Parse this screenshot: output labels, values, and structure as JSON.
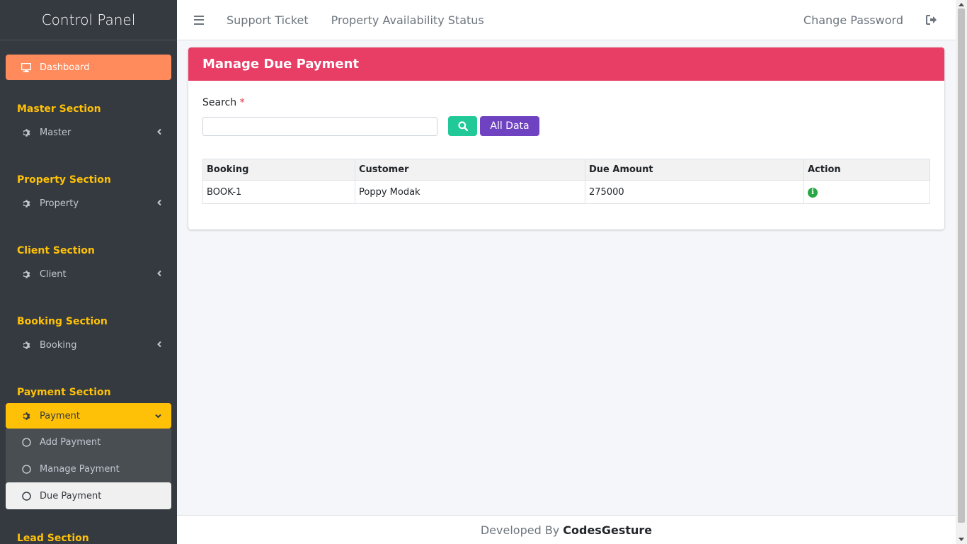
{
  "sidebar": {
    "brand": "Control Panel",
    "dashboard": "Dashboard",
    "sections": [
      {
        "header": "Master Section",
        "item": "Master"
      },
      {
        "header": "Property Section",
        "item": "Property"
      },
      {
        "header": "Client Section",
        "item": "Client"
      },
      {
        "header": "Booking Section",
        "item": "Booking"
      },
      {
        "header": "Payment Section",
        "item": "Payment"
      },
      {
        "header": "Lead Section"
      }
    ],
    "payment_sub": [
      "Add Payment",
      "Manage Payment",
      "Due Payment"
    ]
  },
  "navbar": {
    "support": "Support Ticket",
    "availability": "Property Availability Status",
    "change_password": "Change Password"
  },
  "card": {
    "title": "Manage Due Payment",
    "search_label": "Search",
    "required_mark": "*",
    "search_value": "",
    "all_data_label": "All Data"
  },
  "table": {
    "headers": [
      "Booking",
      "Customer",
      "Due Amount",
      "Action"
    ],
    "rows": [
      {
        "booking": "BOOK-1",
        "customer": "Poppy Modak",
        "due": "275000"
      }
    ]
  },
  "footer": {
    "prefix": "Developed By",
    "brand": "CodesGesture"
  },
  "colors": {
    "sidebar_bg": "#343a40",
    "dashboard_accent": "#ff8a5c",
    "section_header": "#ffc107",
    "card_header": "#e83e66",
    "search_button": "#20c997",
    "all_data_button": "#6f42c1",
    "info_icon": "#28a745"
  },
  "icons": [
    "desktop-icon",
    "gear-icon",
    "chevron-left-icon",
    "chevron-down-icon",
    "circle-icon",
    "bars-icon",
    "sign-out-icon",
    "search-icon",
    "info-circle-icon"
  ]
}
